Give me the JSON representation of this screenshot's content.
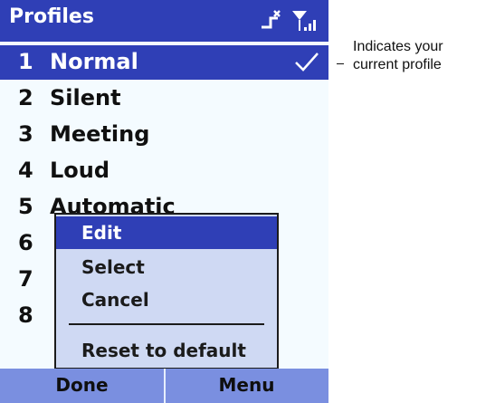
{
  "window": {
    "title": "Profiles"
  },
  "status_icons": [
    "no-sync-icon",
    "signal-icon"
  ],
  "profiles": [
    {
      "num": "1",
      "name": "Normal",
      "selected": true
    },
    {
      "num": "2",
      "name": "Silent"
    },
    {
      "num": "3",
      "name": "Meeting"
    },
    {
      "num": "4",
      "name": "Loud"
    },
    {
      "num": "5",
      "name": "Automatic"
    },
    {
      "num": "6",
      "name": ""
    },
    {
      "num": "7",
      "name": ""
    },
    {
      "num": "8",
      "name": ""
    }
  ],
  "context_menu": {
    "items": [
      "Edit",
      "Select",
      "Cancel",
      "Reset to default"
    ],
    "active_index": 0
  },
  "softkeys": {
    "left": "Done",
    "right": "Menu"
  },
  "annotation": {
    "line1": "Indicates your",
    "line2": "current profile"
  },
  "colors": {
    "title_bar": "#2f3fb6",
    "selection": "#2f3fb6",
    "menu_bg": "#cfd9f3",
    "softkey_bar": "#7a8fe0"
  }
}
